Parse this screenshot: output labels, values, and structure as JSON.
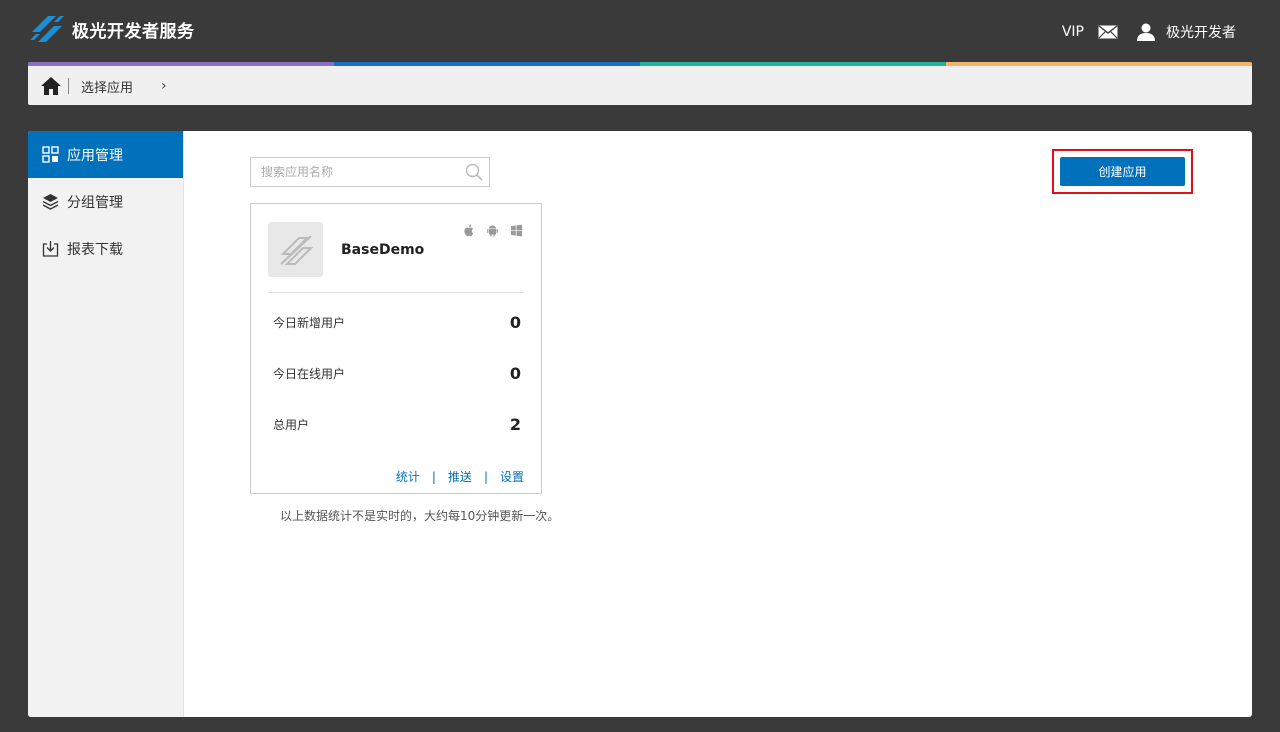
{
  "header": {
    "brand": "极光开发者服务",
    "vip": "VIP",
    "username": "极光开发者"
  },
  "colors": {
    "primary": "#0071ba",
    "highlight": "#e0101a",
    "stripe": [
      "#8b6fc0",
      "#1a6fc0",
      "#21b49a",
      "#f2b46a"
    ]
  },
  "breadcrumb": {
    "label": "选择应用",
    "arrow": "›"
  },
  "sidebar": {
    "items": [
      {
        "label": "应用管理",
        "icon": "grid-icon",
        "active": true
      },
      {
        "label": "分组管理",
        "icon": "layers-icon",
        "active": false
      },
      {
        "label": "报表下载",
        "icon": "download-icon",
        "active": false
      }
    ]
  },
  "search": {
    "placeholder": "搜索应用名称",
    "value": ""
  },
  "create_button": "创建应用",
  "app_card": {
    "name": "BaseDemo",
    "platforms": [
      "apple-icon",
      "android-icon",
      "windows-icon"
    ],
    "stats": [
      {
        "label": "今日新增用户",
        "value": "0"
      },
      {
        "label": "今日在线用户",
        "value": "0"
      },
      {
        "label": "总用户",
        "value": "2"
      }
    ],
    "links": [
      "统计",
      "推送",
      "设置"
    ],
    "link_separator": "|"
  },
  "note": "以上数据统计不是实时的，大约每10分钟更新一次。"
}
